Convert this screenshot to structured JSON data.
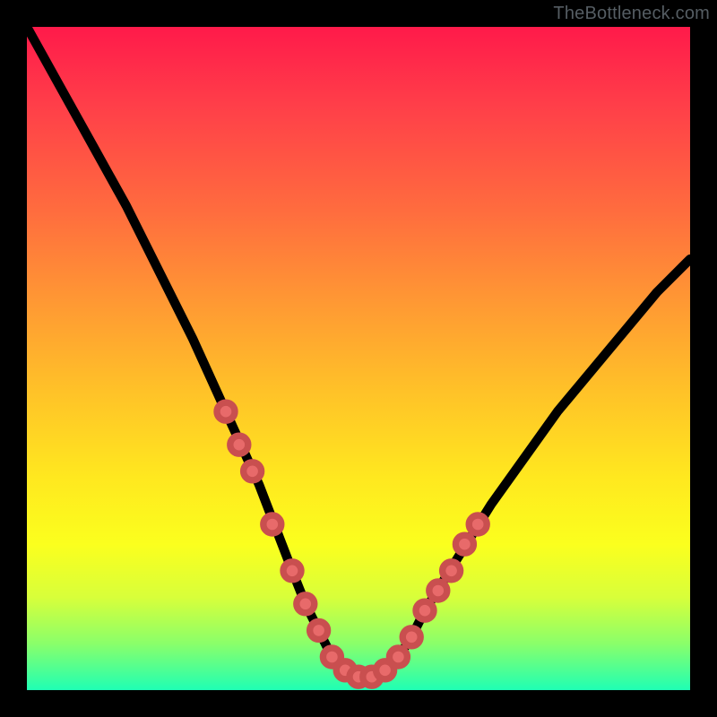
{
  "attribution": "TheBottleneck.com",
  "colors": {
    "frame": "#000000",
    "curve": "#000000",
    "marker_fill": "#e86a6a",
    "marker_stroke": "#c94f4f",
    "gradient_top": "#ff1a4a",
    "gradient_bottom": "#1fffb4",
    "attrib_text": "#555d63"
  },
  "chart_data": {
    "type": "line",
    "title": "",
    "xlabel": "",
    "ylabel": "",
    "xlim": [
      0,
      100
    ],
    "ylim": [
      0,
      100
    ],
    "grid": false,
    "legend": false,
    "note": "Axes are unlabeled in the image. x/y are normalized 0–100 percent of the plot area; y=0 is the bottom edge, y=100 is the top edge.",
    "series": [
      {
        "name": "bottleneck-curve",
        "x": [
          0,
          5,
          10,
          15,
          20,
          25,
          30,
          35,
          40,
          42,
          44,
          46,
          48,
          50,
          52,
          54,
          56,
          58,
          60,
          65,
          70,
          75,
          80,
          85,
          90,
          95,
          100
        ],
        "y": [
          100,
          91,
          82,
          73,
          63,
          53,
          42,
          31,
          18,
          13,
          9,
          5,
          3,
          2,
          2,
          3,
          5,
          8,
          12,
          20,
          28,
          35,
          42,
          48,
          54,
          60,
          65
        ]
      }
    ],
    "markers": {
      "name": "highlight-dots",
      "points": [
        {
          "x": 30,
          "y": 42
        },
        {
          "x": 32,
          "y": 37
        },
        {
          "x": 34,
          "y": 33
        },
        {
          "x": 37,
          "y": 25
        },
        {
          "x": 40,
          "y": 18
        },
        {
          "x": 42,
          "y": 13
        },
        {
          "x": 44,
          "y": 9
        },
        {
          "x": 46,
          "y": 5
        },
        {
          "x": 48,
          "y": 3
        },
        {
          "x": 50,
          "y": 2
        },
        {
          "x": 52,
          "y": 2
        },
        {
          "x": 54,
          "y": 3
        },
        {
          "x": 56,
          "y": 5
        },
        {
          "x": 58,
          "y": 8
        },
        {
          "x": 60,
          "y": 12
        },
        {
          "x": 62,
          "y": 15
        },
        {
          "x": 64,
          "y": 18
        },
        {
          "x": 66,
          "y": 22
        },
        {
          "x": 68,
          "y": 25
        }
      ],
      "radius_percent": 1.35
    }
  }
}
